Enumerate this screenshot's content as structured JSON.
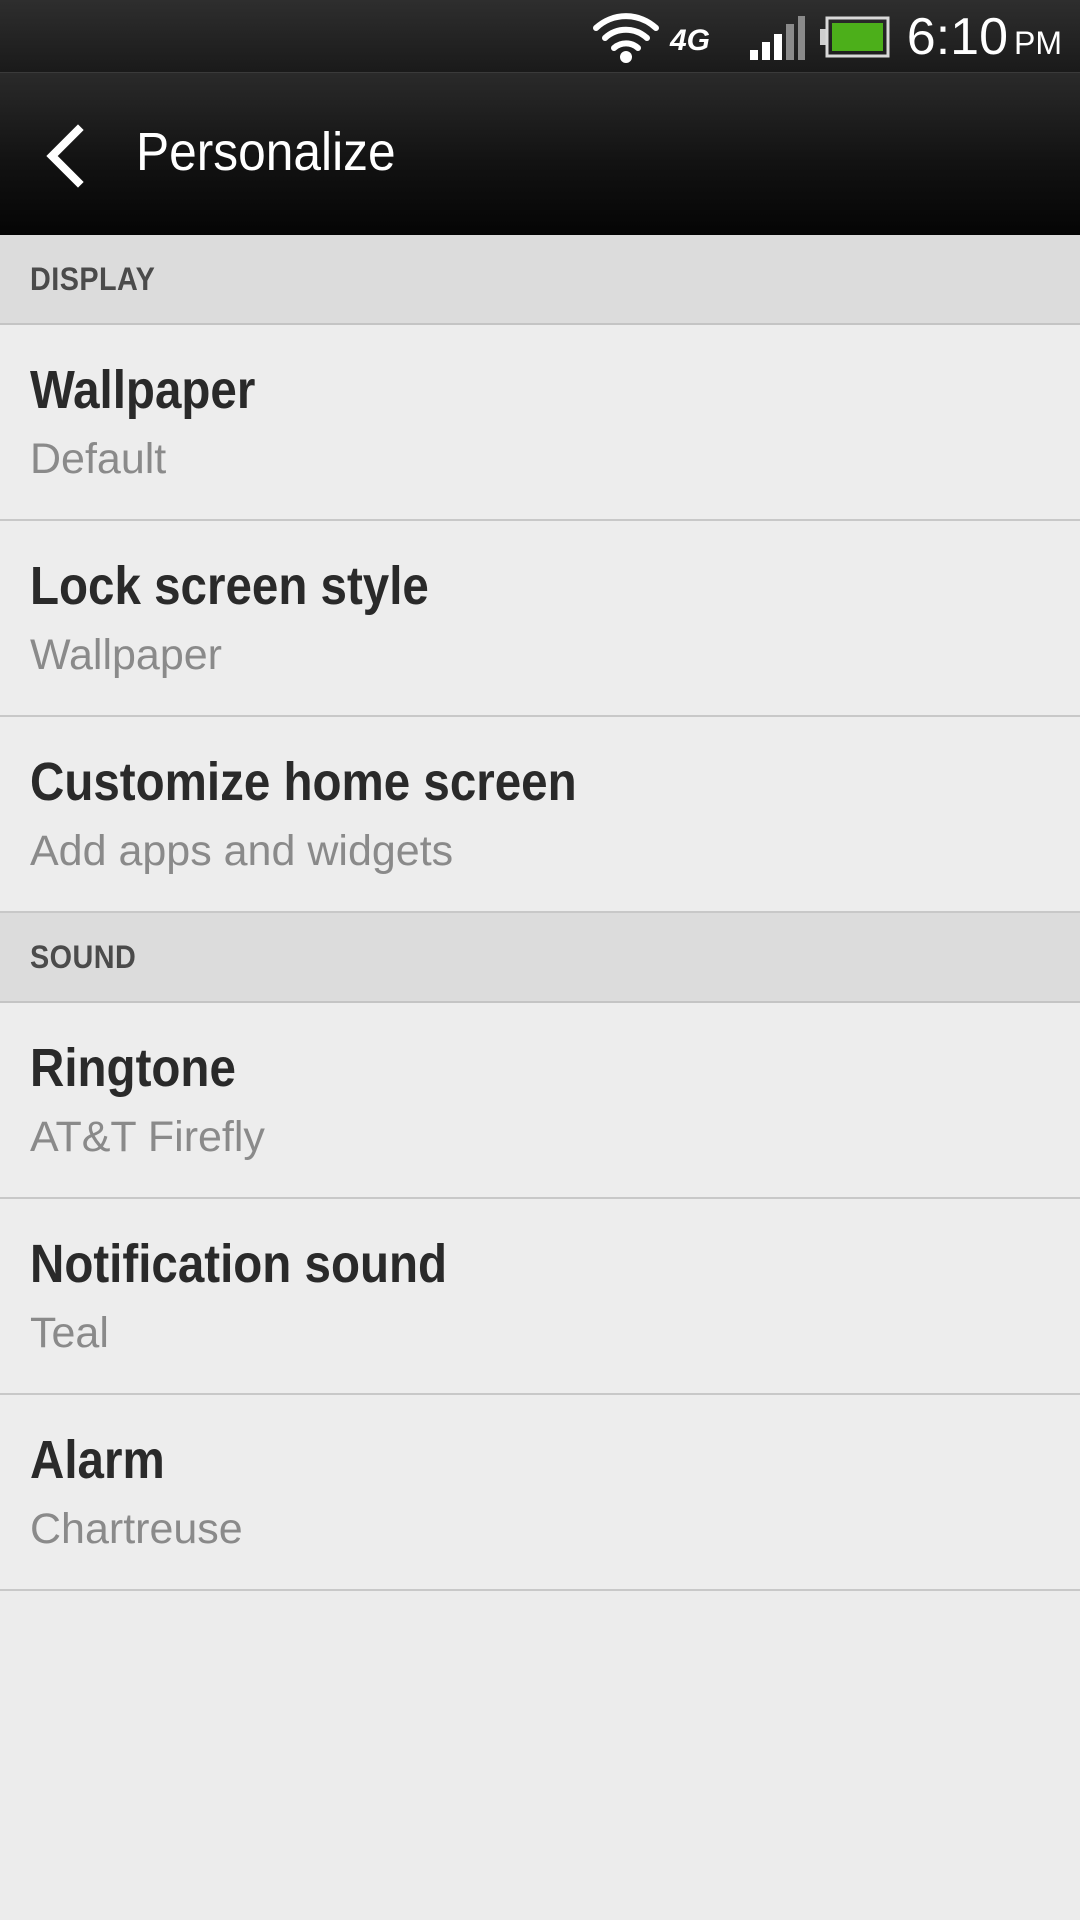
{
  "status_bar": {
    "network_type": "4G",
    "time": "6:10",
    "ampm": "PM",
    "battery_color": "#4caf1a",
    "icons": [
      "wifi-icon",
      "network-type-icon",
      "signal-icon",
      "battery-icon"
    ]
  },
  "action_bar": {
    "back_icon": "chevron-left-icon",
    "title": "Personalize"
  },
  "sections": {
    "display": {
      "header": "DISPLAY",
      "items": [
        {
          "title": "Wallpaper",
          "subtitle": "Default"
        },
        {
          "title": "Lock screen style",
          "subtitle": "Wallpaper"
        },
        {
          "title": "Customize home screen",
          "subtitle": "Add apps and widgets"
        }
      ]
    },
    "sound": {
      "header": "SOUND",
      "items": [
        {
          "title": "Ringtone",
          "subtitle": "AT&T Firefly"
        },
        {
          "title": "Notification sound",
          "subtitle": "Teal"
        },
        {
          "title": "Alarm",
          "subtitle": "Chartreuse"
        }
      ]
    }
  }
}
